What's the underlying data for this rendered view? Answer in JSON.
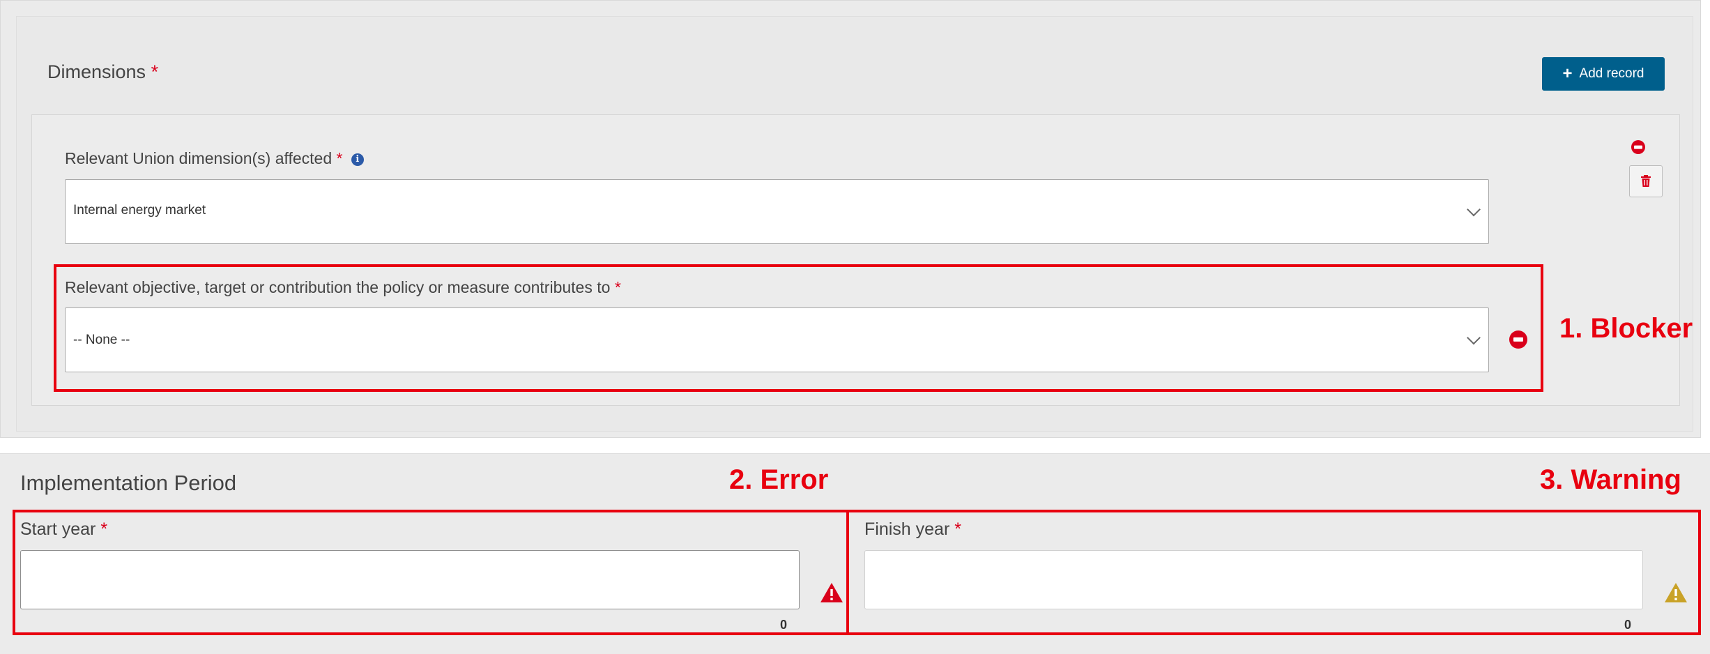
{
  "dimensions": {
    "title": "Dimensions",
    "required_mark": "*",
    "add_button_label": "Add record",
    "record": {
      "union_dimension": {
        "label": "Relevant Union dimension(s) affected",
        "required_mark": "*",
        "value": "Internal energy market"
      },
      "objective": {
        "label": "Relevant objective, target or contribution the policy or measure contributes to",
        "required_mark": "*",
        "value": "-- None --"
      }
    }
  },
  "implementation_period": {
    "title": "Implementation Period",
    "start_year": {
      "label": "Start year",
      "required_mark": "*",
      "value": "",
      "char_count": "0"
    },
    "finish_year": {
      "label": "Finish year",
      "required_mark": "*",
      "value": "",
      "char_count": "0"
    }
  },
  "annotations": {
    "blocker": "1. Blocker",
    "error": "2. Error",
    "warning": "3. Warning"
  },
  "colors": {
    "accent_button": "#005f8c",
    "required": "#d9001b",
    "annotation_red": "#e8000f",
    "error_icon": "#d9001b",
    "warning_icon": "#c9a227",
    "info_icon": "#2b5aa8"
  },
  "icons": {
    "add": "plus-icon",
    "info": "info-icon",
    "remove": "minus-circle-icon",
    "delete": "trash-icon",
    "dropdown": "chevron-down-icon",
    "error": "error-triangle-icon",
    "warning": "warning-triangle-icon"
  }
}
